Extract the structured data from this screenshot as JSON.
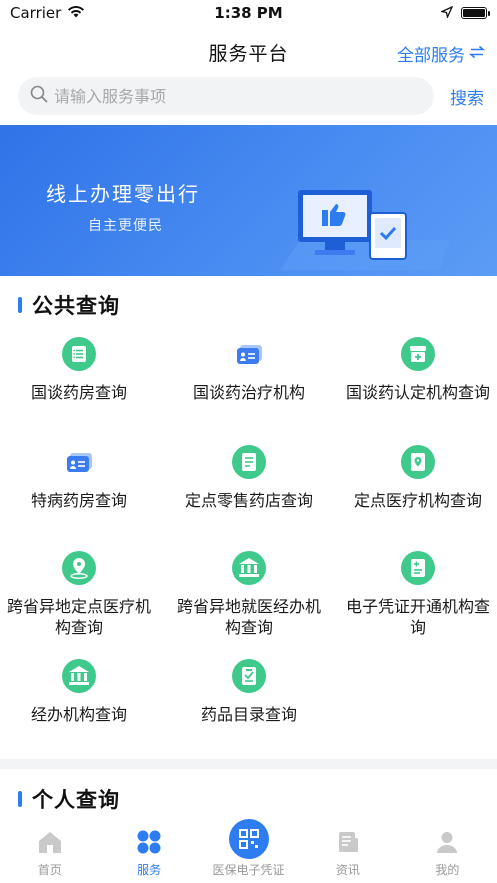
{
  "status": {
    "carrier": "Carrier",
    "time": "1:38 PM"
  },
  "nav": {
    "title": "服务平台",
    "all_services": "全部服务"
  },
  "search": {
    "placeholder": "请输入服务事项",
    "button": "搜索"
  },
  "banner": {
    "title": "线上办理零出行",
    "subtitle": "自主更便民"
  },
  "public": {
    "title": "公共查询",
    "items": [
      {
        "label": "国谈药房查询",
        "icon": "list-icon"
      },
      {
        "label": "国谈药治疗机构",
        "icon": "id-card-icon"
      },
      {
        "label": "国谈药认定机构查询",
        "icon": "medical-box-icon"
      },
      {
        "label": "特病药房查询",
        "icon": "id-card-icon"
      },
      {
        "label": "定点零售药店查询",
        "icon": "document-icon"
      },
      {
        "label": "定点医疗机构查询",
        "icon": "location-doc-icon"
      },
      {
        "label": "跨省异地定点医疗机构查询",
        "icon": "map-pin-icon"
      },
      {
        "label": "跨省异地就医经办机构查询",
        "icon": "bank-icon"
      },
      {
        "label": "电子凭证开通机构查询",
        "icon": "voucher-icon"
      },
      {
        "label": "经办机构查询",
        "icon": "bank-icon"
      },
      {
        "label": "药品目录查询",
        "icon": "drug-catalog-icon"
      }
    ]
  },
  "personal": {
    "title": "个人查询"
  },
  "tabbar": {
    "items": [
      {
        "label": "首页",
        "icon": "home-icon"
      },
      {
        "label": "服务",
        "icon": "services-icon"
      },
      {
        "label": "医保电子凭证",
        "icon": "qr-code-icon"
      },
      {
        "label": "资讯",
        "icon": "news-icon"
      },
      {
        "label": "我的",
        "icon": "user-icon"
      }
    ],
    "active_index": 1
  },
  "colors": {
    "accent": "#2d7df0",
    "icon_green": "#3fc98a",
    "icon_blue": "#3d7cf0"
  }
}
